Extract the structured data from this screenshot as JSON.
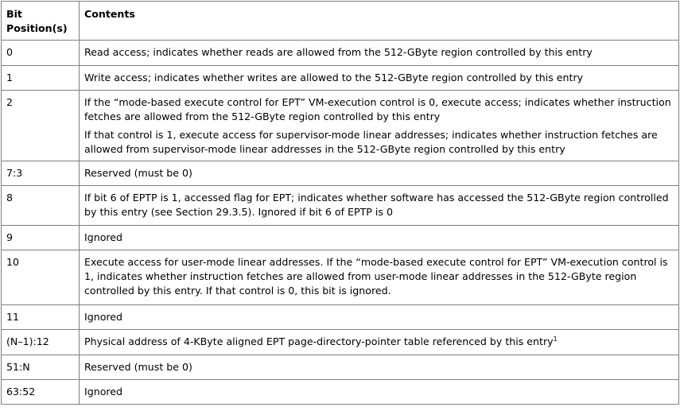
{
  "header": {
    "bit_position": "Bit Position(s)",
    "contents": "Contents"
  },
  "rows": [
    {
      "bit": "0",
      "contents": "Read access; indicates whether reads are allowed from the 512-GByte region controlled by this entry"
    },
    {
      "bit": "1",
      "contents": "Write access; indicates whether writes are allowed to the 512-GByte region controlled by this entry"
    },
    {
      "bit": "2",
      "contents": "If the “mode-based execute control for EPT” VM-execution control is 0, execute access; indicates whether instruction fetches are allowed from the 512-GByte region controlled by this entry",
      "contents_2": "If that control is 1, execute access for supervisor-mode linear addresses; indicates whether instruction fetches are allowed from supervisor-mode linear addresses in the 512-GByte region controlled by this entry"
    },
    {
      "bit": "7:3",
      "contents": "Reserved (must be 0)"
    },
    {
      "bit": "8",
      "contents": "If bit 6 of EPTP is 1, accessed flag for EPT; indicates whether software has accessed the 512-GByte region controlled by this entry (see Section 29.3.5). Ignored if bit 6 of EPTP is 0"
    },
    {
      "bit": "9",
      "contents": "Ignored"
    },
    {
      "bit": "10",
      "contents": "Execute access for user-mode linear addresses. If the “mode-based execute control for EPT” VM-execution control is 1, indicates whether instruction fetches are allowed from user-mode linear addresses in the 512-GByte region controlled by this entry. If that control is 0, this bit is ignored."
    },
    {
      "bit": "11",
      "contents": "Ignored"
    },
    {
      "bit": "(N–1):12",
      "contents": "Physical address of 4-KByte aligned EPT page-directory-pointer table referenced by this entry",
      "footnote": "1"
    },
    {
      "bit": "51:N",
      "contents": "Reserved (must be 0)"
    },
    {
      "bit": "63:52",
      "contents": "Ignored"
    }
  ]
}
